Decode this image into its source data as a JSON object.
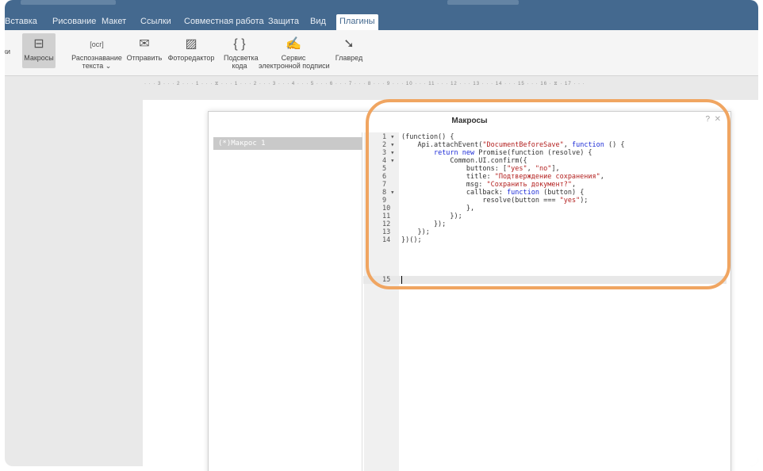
{
  "tabs": [
    {
      "label": "Вставка"
    },
    {
      "label": "Рисование"
    },
    {
      "label": "Макет"
    },
    {
      "label": "Ссылки"
    },
    {
      "label": "Совместная работа"
    },
    {
      "label": "Защита"
    },
    {
      "label": "Вид"
    },
    {
      "label": "Плагины",
      "active": true
    }
  ],
  "toolbar": {
    "partial_left": "ки",
    "macros": "Макросы",
    "ocr_line1": "Распознавание",
    "ocr_line2": "текста ⌄",
    "send": "Отправить",
    "photo_editor": "Фоторедактор",
    "highlight_line1": "Подсветка",
    "highlight_line2": "кода",
    "sign_line1": "Сервис",
    "sign_line2": "электронной подписи",
    "glavred": "Главред"
  },
  "icons": {
    "macros": "macros-icon",
    "ocr": "ocr-icon",
    "send": "envelope-icon",
    "photo": "photo-editor-icon",
    "code": "braces-icon",
    "sign": "signature-icon",
    "glavred": "glavred-icon"
  },
  "ruler": "· · · 3 · · · 2 · · · 1 · · · ⧖ · · · 1 · · · 2 · · · 3 · · · 4 · · · 5 · · · 6 · · · 7 · · · 8 · · · 9 · · · 10 · · · 11 · · · 12 · · · 13 · · · 14 · · · 15 · · · 16 · ⧖ · 17 · · ·",
  "dialog": {
    "title": "Макросы",
    "help": "?",
    "close": "✕",
    "macros": [
      "(*)Макрос 1"
    ]
  },
  "code": {
    "line_numbers": [
      "1 ▾",
      "2 ▾",
      "3 ▾",
      "4 ▾",
      "5",
      "6",
      "7",
      "8 ▾",
      "9",
      "10",
      "11",
      "12",
      "13",
      "14",
      "15"
    ]
  },
  "colors": {
    "ribbon": "#44698f",
    "keyword": "#1c2bd7",
    "string": "#b3201f",
    "highlight": "#f0a561"
  }
}
